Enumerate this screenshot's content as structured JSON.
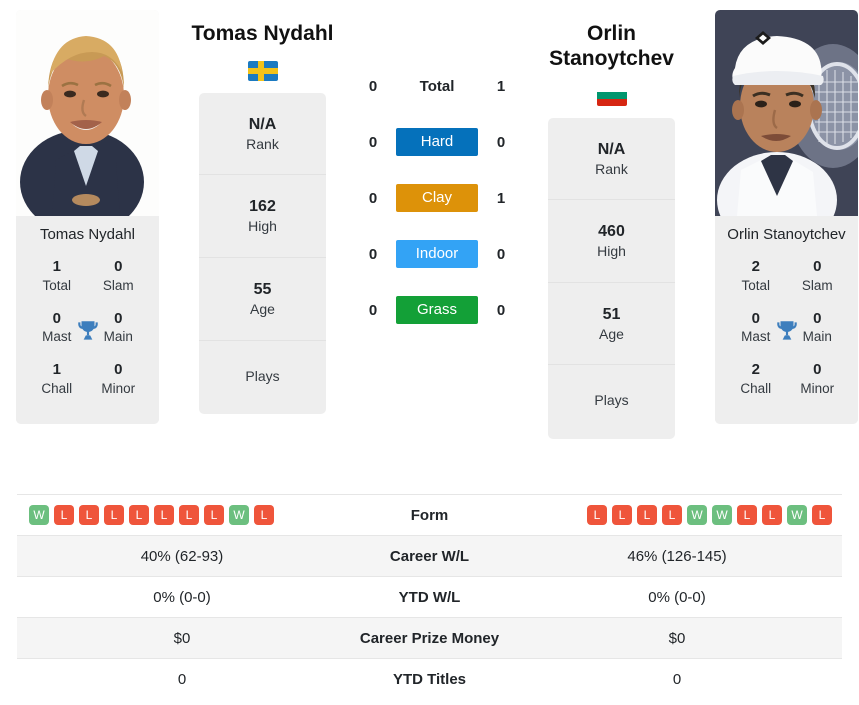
{
  "players": {
    "left": {
      "name": "Tomas Nydahl",
      "flag_country": "Sweden",
      "photo_caption": "Tomas Nydahl",
      "titles": {
        "total_value": "1",
        "total_label": "Total",
        "slam_value": "0",
        "slam_label": "Slam",
        "mast_value": "0",
        "mast_label": "Mast",
        "main_value": "0",
        "main_label": "Main",
        "chall_value": "1",
        "chall_label": "Chall",
        "minor_value": "0",
        "minor_label": "Minor"
      },
      "info": {
        "rank_value": "N/A",
        "rank_label": "Rank",
        "high_value": "162",
        "high_label": "High",
        "age_value": "55",
        "age_label": "Age",
        "plays_label": "Plays"
      }
    },
    "right": {
      "name": "Orlin Stanoytchev",
      "flag_country": "Bulgaria",
      "photo_caption": "Orlin Stanoytchev",
      "titles": {
        "total_value": "2",
        "total_label": "Total",
        "slam_value": "0",
        "slam_label": "Slam",
        "mast_value": "0",
        "mast_label": "Mast",
        "main_value": "0",
        "main_label": "Main",
        "chall_value": "2",
        "chall_label": "Chall",
        "minor_value": "0",
        "minor_label": "Minor"
      },
      "info": {
        "rank_value": "N/A",
        "rank_label": "Rank",
        "high_value": "460",
        "high_label": "High",
        "age_value": "51",
        "age_label": "Age",
        "plays_label": "Plays"
      }
    }
  },
  "h2h": {
    "rows": [
      {
        "label": "Total",
        "left": "0",
        "right": "1",
        "type": "plain",
        "color": ""
      },
      {
        "label": "Hard",
        "left": "0",
        "right": "0",
        "type": "badge",
        "color": "#0571bb"
      },
      {
        "label": "Clay",
        "left": "0",
        "right": "1",
        "type": "badge",
        "color": "#dd9209"
      },
      {
        "label": "Indoor",
        "left": "0",
        "right": "0",
        "type": "badge",
        "color": "#33a3f5"
      },
      {
        "label": "Grass",
        "left": "0",
        "right": "0",
        "type": "badge",
        "color": "#13a037"
      }
    ]
  },
  "stats": {
    "form_label": "Form",
    "form_left": [
      "W",
      "L",
      "L",
      "L",
      "L",
      "L",
      "L",
      "L",
      "W",
      "L"
    ],
    "form_right": [
      "L",
      "L",
      "L",
      "L",
      "W",
      "W",
      "L",
      "L",
      "W",
      "L"
    ],
    "rows": [
      {
        "label": "Career W/L",
        "left": "40% (62-93)",
        "right": "46% (126-145)"
      },
      {
        "label": "YTD W/L",
        "left": "0% (0-0)",
        "right": "0% (0-0)"
      },
      {
        "label": "Career Prize Money",
        "left": "$0",
        "right": "$0"
      },
      {
        "label": "YTD Titles",
        "left": "0",
        "right": "0"
      }
    ]
  },
  "colors": {
    "win": "#6cbf7f",
    "loss": "#ef553b",
    "trophy": "#3d7ebd",
    "card_bg": "#eeeeee",
    "row_shade": "#f5f5f5"
  }
}
